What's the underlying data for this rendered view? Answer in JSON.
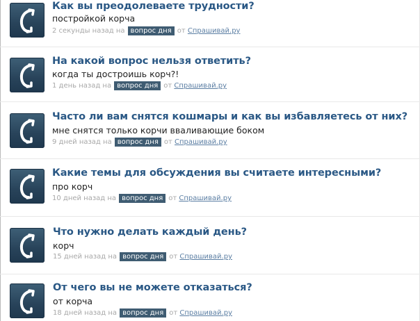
{
  "feed": {
    "items": [
      {
        "title": "Как вы преодолеваете трудности?",
        "answer": "постройкой корча",
        "time": "2 секунды назад на",
        "badge": "вопрос дня",
        "from": "от",
        "site": "Спрашивай.ру"
      },
      {
        "title": "На какой вопрос нельзя ответить?",
        "answer": "когда ты достроишь корч?!",
        "time": "1 день назад на",
        "badge": "вопрос дня",
        "from": "от",
        "site": "Спрашивай.ру"
      },
      {
        "title": "Часто ли вам снятся кошмары и как вы избавляетесь от них?",
        "answer": "мне снятся только корчи вваливающие боком",
        "time": "9 дней назад на",
        "badge": "вопрос дня",
        "from": "от",
        "site": "Спрашивай.ру"
      },
      {
        "title": "Какие темы для обсуждения вы считаете интересными?",
        "answer": "про корч",
        "time": "10 дней назад на",
        "badge": "вопрос дня",
        "from": "от",
        "site": "Спрашивай.ру"
      },
      {
        "title": "Что нужно делать каждый день?",
        "answer": "корч",
        "time": "15 дней назад на",
        "badge": "вопрос дня",
        "from": "от",
        "site": "Спрашивай.ру"
      },
      {
        "title": "От чего вы не можете отказаться?",
        "answer": "от корча",
        "time": "18 дней назад на",
        "badge": "вопрос дня",
        "from": "от",
        "site": "Спрашивай.ру"
      }
    ]
  },
  "colors": {
    "title": "#2a5885",
    "badge_bg": "#3f5c72",
    "avatar": "#2b4a62",
    "meta": "#a8a8a8"
  },
  "icons": {
    "avatar": "phone-handset-icon"
  }
}
